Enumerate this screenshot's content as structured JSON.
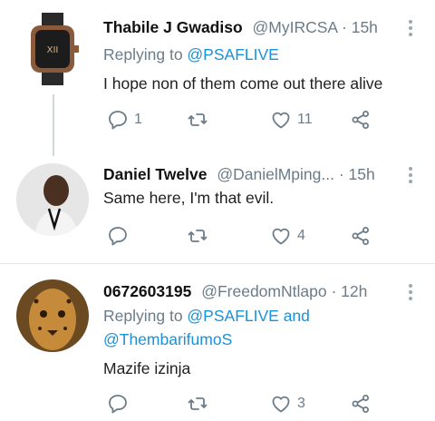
{
  "tweets": [
    {
      "name": "Thabile J Gwadiso",
      "handle": "@MyIRCSA",
      "sep": " · ",
      "time": "15h",
      "replying_prefix": "Replying to ",
      "replying_line1": "@PSAFLIVE",
      "replying_and": "",
      "replying_line2": "",
      "text": "I hope non of them come out there alive",
      "replies": "1",
      "retweets": "",
      "likes": "11"
    },
    {
      "name": "Daniel Twelve",
      "handle": "@DanielMping...",
      "sep": " · ",
      "time": "15h",
      "text": "Same here, I'm that evil.",
      "replies": "",
      "retweets": "",
      "likes": "4"
    },
    {
      "name": "0672603195",
      "handle": "@FreedomNtlapo",
      "sep": " · ",
      "time": "12h",
      "replying_prefix": "Replying to ",
      "replying_line1": "@PSAFLIVE and",
      "replying_line2": "@ThembarifumoS",
      "text": "Mazife izinja",
      "replies": "",
      "retweets": "",
      "likes": "3"
    }
  ],
  "colors": {
    "link": "#1a91da",
    "muted": "#6b7c88",
    "divider": "#e3e7ea"
  },
  "icons": [
    "reply-icon",
    "retweet-icon",
    "like-icon",
    "share-icon",
    "more-icon"
  ]
}
